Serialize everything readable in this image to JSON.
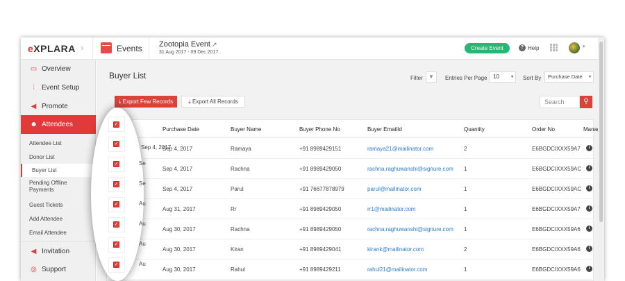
{
  "topbar": {
    "logo": "XPLARA",
    "logo_e": "e",
    "events_label": "Events",
    "event_title": "Zootopia Event",
    "event_dates": "31 Aug 2017 - 09 Dec 2017 .",
    "create_event": "Create Event",
    "help": "Help",
    "help_glyph": "?",
    "external_glyph": "↗",
    "chevron": "›",
    "caret": "▾"
  },
  "sidebar": {
    "items": [
      {
        "label": "Overview",
        "icon": "monitor-icon",
        "glyph": "▭"
      },
      {
        "label": "Event Setup",
        "icon": "sliders-icon",
        "glyph": "⫶"
      },
      {
        "label": "Promote",
        "icon": "megaphone-icon",
        "glyph": "◀"
      },
      {
        "label": "Attendees",
        "icon": "users-icon",
        "glyph": "☻"
      }
    ],
    "sub_items": [
      {
        "label": "Attendee List"
      },
      {
        "label": "Donor List"
      },
      {
        "label": "Buyer List"
      },
      {
        "label": "Pending Offline Payments"
      },
      {
        "label": "Guest Tickets"
      },
      {
        "label": "Add Attendee"
      },
      {
        "label": "Email Attendee"
      }
    ],
    "bottom_items": [
      {
        "label": "Invitation",
        "icon": "megaphone-icon",
        "glyph": "◀"
      },
      {
        "label": "Support",
        "icon": "headset-icon",
        "glyph": "◎"
      }
    ]
  },
  "main": {
    "title": "Buyer List",
    "filter_label": "Filter",
    "filter_glyph": "▼",
    "entries_label": "Entries Per Page",
    "entries_value": "10",
    "sort_label": "Sort By",
    "sort_value": "Purchase Date",
    "export_few": "Export Few Records",
    "export_all": "Export All Records",
    "search_placeholder": "Search",
    "search_glyph": "⚲",
    "check_glyph": "✓",
    "info_glyph": "i",
    "gear_glyph": "✲"
  },
  "table": {
    "headers": [
      "Purchase Date",
      "Buyer Name",
      "Buyer Phone No",
      "Buyer EmailId",
      "Quantity",
      "Order No",
      "Manage"
    ],
    "rows": [
      {
        "date": "Sep 4, 2017",
        "name": "Ramaya",
        "phone": "+91 8989429151",
        "email": "ramaya21@mailinator.com",
        "qty": "2",
        "order": "E6BGDCIXXX59A7"
      },
      {
        "date": "Sep 4, 2017",
        "name": "Rachna",
        "phone": "+91 8989429050",
        "email": "rachna.raghuwanshi@signure.com",
        "qty": "1",
        "order": "E6BGDCIXXX59AC"
      },
      {
        "date": "Sep 4, 2017",
        "name": "Parul",
        "phone": "+91 76677878979",
        "email": "parul@mailinator.com",
        "qty": "1",
        "order": "E6BGDCIXXX59AC"
      },
      {
        "date": "Aug 31, 2017",
        "name": "Rr",
        "phone": "+91 8989429050",
        "email": "rr1@mailinator.com",
        "qty": "1",
        "order": "E6BGDCIXXX59A7"
      },
      {
        "date": "Aug 30, 2017",
        "name": "Rachna",
        "phone": "+91 8989429050",
        "email": "rachna.raghuwanshi@signure.com",
        "qty": "1",
        "order": "E6BGDCIXXX59A6"
      },
      {
        "date": "Aug 30, 2017",
        "name": "Kiran",
        "phone": "+91 8989429041",
        "email": "kirank@mailinator.com",
        "qty": "2",
        "order": "E6BGDCIXXX59A6"
      },
      {
        "date": "Aug 30, 2017",
        "name": "Rahul",
        "phone": "+91 8989429211",
        "email": "rahul21@mailinator.com",
        "qty": "1",
        "order": "E6BGDCIXXX59A6"
      }
    ]
  },
  "overlay": {
    "clipped_dates": [
      "Sep 4, 2017",
      "Se",
      "Se",
      "Au",
      "Au",
      "Au",
      "Au"
    ]
  },
  "colors": {
    "accent": "#e03a3a",
    "create_green": "#2ab572",
    "link_blue": "#2b7bd3"
  }
}
